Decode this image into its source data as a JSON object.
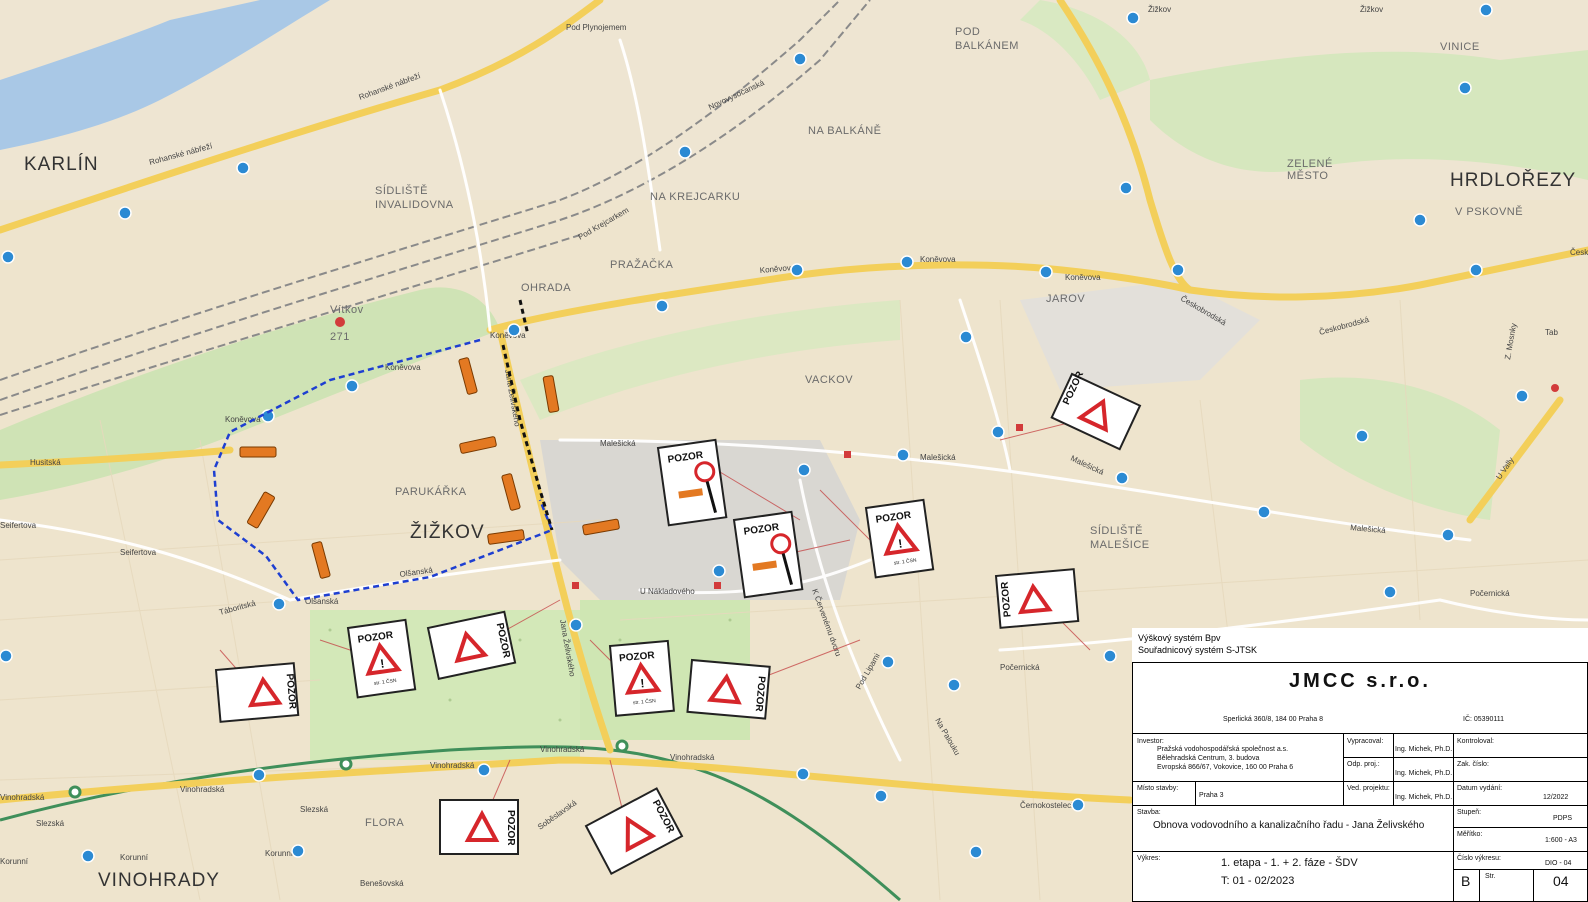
{
  "map": {
    "districts": [
      "KARLÍN",
      "ŽIŽKOV",
      "VINOHRADY",
      "HRDLOŘEZY"
    ],
    "quarters": [
      "SÍDLIŠTĚ",
      "INVALIDOVNA",
      "NA BALKÁNĚ",
      "NA KREJCARKU",
      "POD",
      "BALKÁNEM",
      "VINICE",
      "ZELENÉ",
      "MĚSTO",
      "JAROV",
      "VACKOV",
      "PARUKÁŘKA",
      "OHRADA",
      "PRAŽAČKA",
      "SÍDLIŠTĚ",
      "MALEŠICE",
      "FLORA",
      "V PSKOVNĚ",
      "Vítkov",
      "271"
    ],
    "streets": [
      "Rohanské nábřeží",
      "Rohanské nábřeží",
      "Pod Plynojemem",
      "Novovysočanská",
      "Pod Krejcarkem",
      "Koněvova",
      "Koněvova",
      "Koněvova",
      "Českobrodská",
      "Českobrodská",
      "Husitská",
      "Malešická",
      "Malešická",
      "Malešická",
      "Malešická",
      "U Nákladového",
      "Táboritská",
      "Olšanská",
      "Olšanská",
      "Seifertova",
      "Seifertova",
      "Vinohradská",
      "Vinohradská",
      "Vinohradská",
      "Vinohradská",
      "Korunní",
      "Korunní",
      "Slezská",
      "Slezská",
      "Počernická",
      "Počernická",
      "Černokostelecká",
      "Vinohradská",
      "Korunní",
      "Benešovská",
      "Koněvova",
      "Koněvova",
      "Koněvova",
      "Žižkov",
      "Žižkov",
      "Pod Lipami",
      "Na Palouku",
      "K Červenému dvoru",
      "Jana Želivského",
      "Jana Želivského",
      "Soběslavská",
      "U Vally",
      "Českobrodská",
      "Z. Mosnky",
      "Tab"
    ]
  },
  "signs": {
    "pozor": "POZOR",
    "note": "str. 1 ČSN"
  },
  "titleblock": {
    "height_system": "Výškový systém Bpv",
    "coord_system": "Souřadnicový systém S-JTSK",
    "company": "JMCC s.r.o.",
    "company_address": "Sperlická 360/8, 184 00 Praha 8",
    "company_ic": "IČ: 05390111",
    "investor": "Pražská vodohospodářská společnost a.s.",
    "investor_addr1": "Bělehradská Centrum, 3. budova",
    "investor_addr2": "Evropská 866/67, Vokovice, 160 00 Praha 6",
    "vypracoval": "Ing. Michek, Ph.D.",
    "odp_proj": "Ing. Michek, Ph.D.",
    "ved_projektu": "Ing. Michek, Ph.D.",
    "misto_stavby": "Praha 3",
    "datum": "12/2022",
    "stavba": "Obnova vodovodního a kanalizačního řadu - Jana Želivského",
    "stupen": "PDPS",
    "meritko": "1:600 - A3",
    "vykres_1": "1. etapa - 1. + 2. fáze - ŠDV",
    "vykres_2": "T: 01 - 02/2023",
    "cislo_vykresu": "DIO - 04",
    "revision": "B",
    "sheet": "04",
    "labels": {
      "investor": "Investor:",
      "vypracoval": "Vypracoval:",
      "odp_proj": "Odp. proj.:",
      "ved_projektu": "Ved. projektu:",
      "misto_stavby": "Místo stavby:",
      "kontroloval": "Kontroloval:",
      "zak_cislo": "Zak. číslo:",
      "datum": "Datum vydání:",
      "stavba": "Stavba:",
      "stupen": "Stupeň:",
      "meritko": "Měřítko:",
      "vykres": "Výkres:",
      "cislo_vykresu": "Číslo výkresu:",
      "sheet": "Str."
    }
  }
}
